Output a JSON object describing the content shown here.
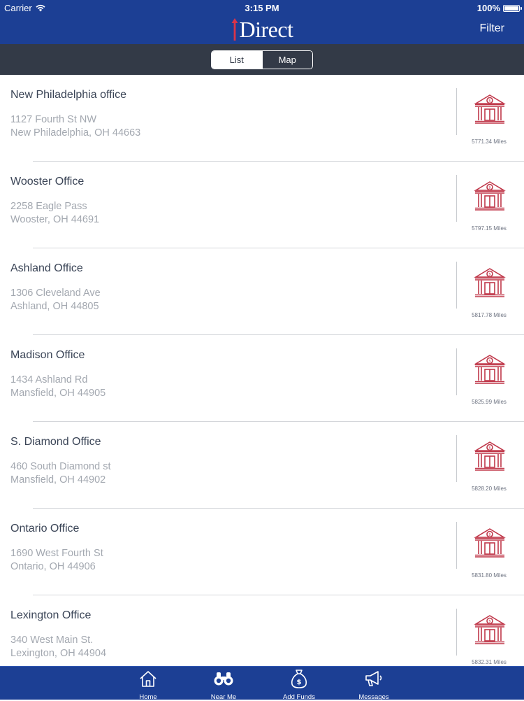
{
  "status_bar": {
    "carrier": "Carrier",
    "time": "3:15 PM",
    "battery": "100%"
  },
  "header": {
    "logo_text": "Direct",
    "filter_label": "Filter"
  },
  "view_toggle": {
    "list_label": "List",
    "map_label": "Map",
    "selected": "List"
  },
  "offices": [
    {
      "name": "New Philadelphia office",
      "address_line1": "1127 Fourth St NW",
      "address_line2": "New Philadelphia, OH 44663",
      "distance": "5771.34 Miles"
    },
    {
      "name": "Wooster Office",
      "address_line1": "2258 Eagle Pass",
      "address_line2": "Wooster, OH 44691",
      "distance": "5797.15 Miles"
    },
    {
      "name": "Ashland Office",
      "address_line1": "1306 Cleveland Ave",
      "address_line2": "Ashland, OH 44805",
      "distance": "5817.78 Miles"
    },
    {
      "name": "Madison Office",
      "address_line1": "1434 Ashland Rd",
      "address_line2": "Mansfield, OH 44905",
      "distance": "5825.99 Miles"
    },
    {
      "name": "S. Diamond Office",
      "address_line1": "460 South Diamond st",
      "address_line2": "Mansfield, OH 44902",
      "distance": "5828.20 Miles"
    },
    {
      "name": "Ontario Office",
      "address_line1": "1690 West Fourth St",
      "address_line2": "Ontario, OH 44906",
      "distance": "5831.80 Miles"
    },
    {
      "name": "Lexington Office",
      "address_line1": "340 West Main St.",
      "address_line2": "Lexington, OH 44904",
      "distance": "5832.31 Miles"
    }
  ],
  "tab_bar": {
    "items": [
      {
        "label": "Home",
        "icon": "house-icon"
      },
      {
        "label": "Near Me",
        "icon": "binoculars-icon"
      },
      {
        "label": "Add Funds",
        "icon": "money-bag-icon"
      },
      {
        "label": "Messages",
        "icon": "megaphone-icon"
      }
    ]
  },
  "colors": {
    "brand_blue": "#1c3f94",
    "toolbar_gray": "#333a47",
    "bank_icon_red": "#c0384a"
  }
}
